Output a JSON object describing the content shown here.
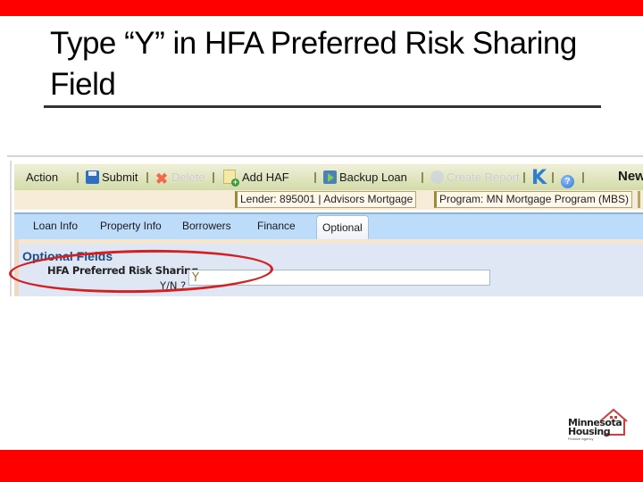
{
  "slide": {
    "title": "Type “Y” in HFA Preferred Risk Sharing Field",
    "brand_color": "#ff0000"
  },
  "app": {
    "toolbar": {
      "action_label": "Action",
      "submit_label": "Submit",
      "delete_label": "Delete",
      "add_haf_label": "Add HAF",
      "backup_loan_label": "Backup Loan",
      "create_report_label": "Create Report",
      "help_icon_glyph": "?",
      "first_icon_glyph": "K",
      "new_label": "New"
    },
    "info": {
      "lender": "Lender: 895001 | Advisors Mortgage",
      "program": "Program: MN Mortgage Program (MBS)"
    },
    "tabs": [
      {
        "label": "Loan Info",
        "active": false
      },
      {
        "label": "Property Info",
        "active": false
      },
      {
        "label": "Borrowers",
        "active": false
      },
      {
        "label": "Finance",
        "active": false
      },
      {
        "label": "Optional",
        "active": true
      }
    ],
    "panel": {
      "title": "Optional Fields",
      "field_label_line1": "HFA Preferred Risk Sharing",
      "field_label_line2": "Y/N ?",
      "field_value": "Y"
    }
  },
  "logo": {
    "line1": "Minnesota",
    "line2": "Housing",
    "line3": "Finance Agency"
  }
}
